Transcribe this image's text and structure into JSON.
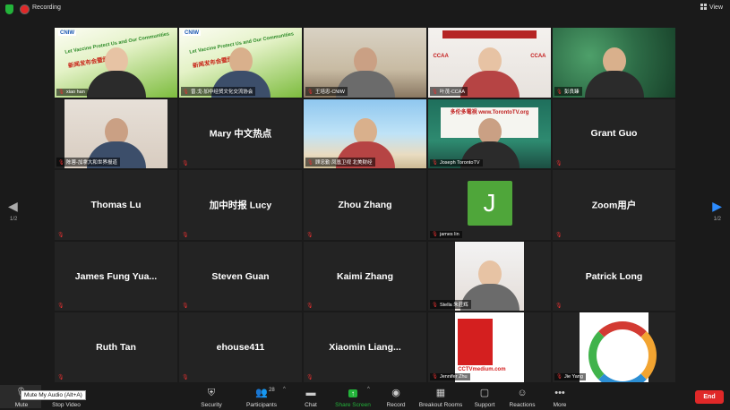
{
  "topbar": {
    "recording_label": "Recording",
    "view_label": "View"
  },
  "pagination": {
    "left": "1/2",
    "right": "1/2"
  },
  "tiles": [
    {
      "kind": "video",
      "bg": "banner",
      "label": "xiao han"
    },
    {
      "kind": "video",
      "bg": "banner",
      "label": "曾.戈-加中经贸文化交流协会"
    },
    {
      "kind": "video",
      "bg": "office",
      "label": "王培忠-CNIW",
      "active": true
    },
    {
      "kind": "video",
      "bg": "ccaa",
      "label": "叶茂-CCAA"
    },
    {
      "kind": "video",
      "bg": "forest",
      "label": "彭良臻"
    },
    {
      "kind": "video",
      "bg": "redhair",
      "label": "陈蓉-加拿大和世界报道"
    },
    {
      "kind": "name",
      "name": "Mary 中文热点"
    },
    {
      "kind": "video",
      "bg": "beach",
      "label": "顾忠勤 凤凰卫视 北美财经"
    },
    {
      "kind": "video",
      "bg": "studio",
      "label": "Joseph TorontoTV"
    },
    {
      "kind": "name",
      "name": "Grant Guo"
    },
    {
      "kind": "name",
      "name": "Thomas Lu"
    },
    {
      "kind": "name",
      "name": "加中时报 Lucy"
    },
    {
      "kind": "name",
      "name": "Zhou Zhang"
    },
    {
      "kind": "avatar",
      "letter": "J",
      "label": "james lin"
    },
    {
      "kind": "name",
      "name": "Zoom用户"
    },
    {
      "kind": "name",
      "name": "James Fung Yua..."
    },
    {
      "kind": "name",
      "name": "Steven Guan"
    },
    {
      "kind": "name",
      "name": "Kaimi Zhang"
    },
    {
      "kind": "video",
      "bg": "stella",
      "label": "Stella 朱莊辉"
    },
    {
      "kind": "name",
      "name": "Patrick Long"
    },
    {
      "kind": "name",
      "name": "Ruth Tan"
    },
    {
      "kind": "name",
      "name": "ehouse411"
    },
    {
      "kind": "name",
      "name": "Xiaomin Liang..."
    },
    {
      "kind": "video",
      "bg": "cctv",
      "label": "Jennifer Zhu"
    },
    {
      "kind": "video",
      "bg": "ring",
      "label": "Jie Yang"
    }
  ],
  "video_text": {
    "banner_line1": "Let Vaccine Protect Us and Our Communities",
    "banner_line2": "新闻发布会暨颁奖仪式",
    "banner_logo": "CNIW",
    "ccaa_logo": "CCAA",
    "studio_sign": "多伦多電視 www.TorontoTV.org",
    "cctv_url": "CCTVmedium.com"
  },
  "toolbar": {
    "mute": "Mute",
    "stop_video": "Stop Video",
    "security": "Security",
    "participants": "Participants",
    "participants_count": "28",
    "chat": "Chat",
    "share_screen": "Share Screen",
    "record": "Record",
    "breakout_rooms": "Breakout Rooms",
    "support": "Support",
    "reactions": "Reactions",
    "more": "More",
    "end": "End",
    "mute_tooltip": "Mute My Audio (Alt+A)"
  },
  "colors": {
    "active_speaker": "#c6d400",
    "share_green": "#23b33a",
    "end_red": "#e02828",
    "nav_blue": "#2d8cff"
  }
}
